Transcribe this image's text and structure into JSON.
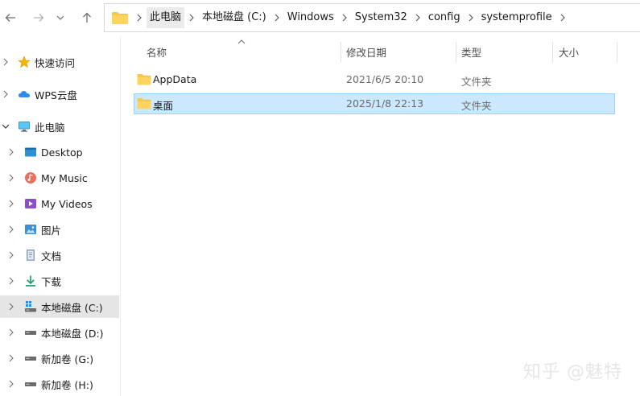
{
  "breadcrumb": [
    "此电脑",
    "本地磁盘 (C:)",
    "Windows",
    "System32",
    "config",
    "systemprofile"
  ],
  "columns": {
    "name": "名称",
    "modified": "修改日期",
    "type": "类型",
    "size": "大小"
  },
  "files": [
    {
      "name": "AppData",
      "modified": "2021/6/5 20:10",
      "type": "文件夹",
      "selected": false
    },
    {
      "name": "桌面",
      "modified": "2025/1/8 22:13",
      "type": "文件夹",
      "selected": true
    }
  ],
  "sidebar": [
    {
      "label": "快速访问",
      "icon": "star-icon",
      "chevron": "right"
    },
    {
      "label": "WPS云盘",
      "icon": "cloud-icon",
      "chevron": "right"
    },
    {
      "label": "此电脑",
      "icon": "computer-icon",
      "chevron": "down"
    },
    {
      "label": "Desktop",
      "icon": "desktop-icon",
      "chevron": "right"
    },
    {
      "label": "My Music",
      "icon": "music-icon",
      "chevron": "right"
    },
    {
      "label": "My Videos",
      "icon": "video-icon",
      "chevron": "right"
    },
    {
      "label": "图片",
      "icon": "pictures-icon",
      "chevron": "right"
    },
    {
      "label": "文档",
      "icon": "documents-icon",
      "chevron": "right"
    },
    {
      "label": "下载",
      "icon": "download-icon",
      "chevron": "right"
    },
    {
      "label": "本地磁盘 (C:)",
      "icon": "system-drive-icon",
      "chevron": "right",
      "selected": true
    },
    {
      "label": "本地磁盘 (D:)",
      "icon": "drive-icon",
      "chevron": "right"
    },
    {
      "label": "新加卷 (G:)",
      "icon": "drive-icon",
      "chevron": "right"
    },
    {
      "label": "新加卷 (H:)",
      "icon": "drive-icon",
      "chevron": "right"
    }
  ],
  "watermark": "知乎 @魅特",
  "colors": {
    "selection_bg": "#cce8ff",
    "selection_border": "#99d1ff",
    "folder": "#f5c84c",
    "nav_selected": "#e5e5e5"
  }
}
